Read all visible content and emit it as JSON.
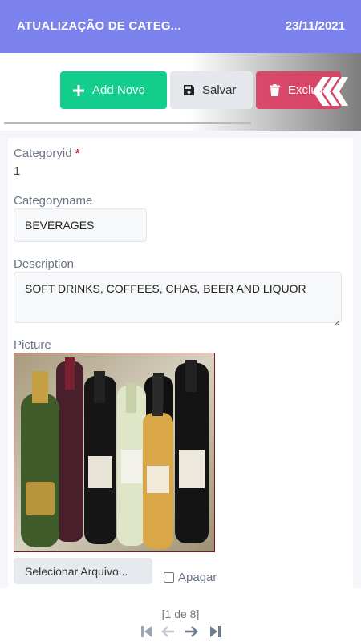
{
  "header": {
    "title": "ATUALIZAÇÃO DE CATEG...",
    "date": "23/11/2021"
  },
  "toolbar": {
    "add_label": "Add Novo",
    "save_label": "Salvar",
    "delete_label": "Excluir"
  },
  "form": {
    "categoryid": {
      "label": "Categoryid",
      "required_mark": "*",
      "value": "1"
    },
    "categoryname": {
      "label": "Categoryname",
      "value": "BEVERAGES"
    },
    "description": {
      "label": "Description",
      "value": "SOFT DRINKS, COFFEES, CHAS, BEER AND LIQUOR"
    },
    "picture": {
      "label": "Picture",
      "select_file_label": "Selecionar Arquivo...",
      "delete_label": "Apagar",
      "delete_checked": false
    }
  },
  "pager": {
    "info": "[1 de 8]"
  },
  "colors": {
    "header": "#7b82ee",
    "add": "#13cd8c",
    "save": "#e4e7ec",
    "delete": "#dc3f63"
  },
  "icons": [
    "plus-icon",
    "floppy-disk-icon",
    "trash-icon",
    "collapse-chevrons-icon",
    "first-page-icon",
    "prev-page-icon",
    "next-page-icon",
    "last-page-icon"
  ]
}
